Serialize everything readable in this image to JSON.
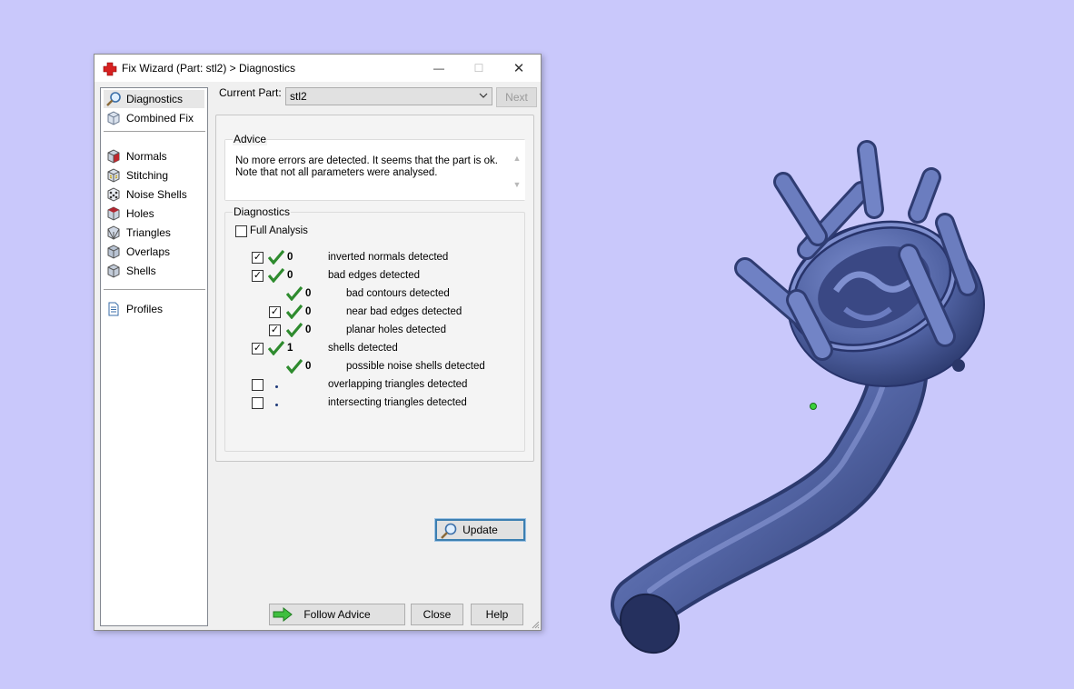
{
  "window": {
    "title": "Fix Wizard (Part: stl2) > Diagnostics",
    "minimize": "—",
    "maximize": "☐",
    "close": "✕"
  },
  "nav": {
    "items": [
      {
        "label": "Diagnostics",
        "icon": "magnifier-icon"
      },
      {
        "label": "Combined Fix",
        "icon": "cube-icon"
      },
      {
        "label": "Normals",
        "icon": "normals-cube-icon"
      },
      {
        "label": "Stitching",
        "icon": "stitching-cube-icon"
      },
      {
        "label": "Noise Shells",
        "icon": "noise-shells-cube-icon"
      },
      {
        "label": "Holes",
        "icon": "holes-cube-icon"
      },
      {
        "label": "Triangles",
        "icon": "triangles-cube-icon"
      },
      {
        "label": "Overlaps",
        "icon": "overlaps-cube-icon"
      },
      {
        "label": "Shells",
        "icon": "shells-cube-icon"
      },
      {
        "label": "Profiles",
        "icon": "document-icon"
      }
    ]
  },
  "current_part": {
    "label": "Current Part:",
    "value": "stl2",
    "next_label": "Next"
  },
  "advice": {
    "title": "Advice",
    "line1": "No more errors are detected. It seems that the part is ok.",
    "line2": "Note that not all parameters were analysed."
  },
  "diagnostics": {
    "title": "Diagnostics",
    "full_analysis": "Full Analysis",
    "rows": [
      {
        "checked": true,
        "status": "ok",
        "count": "0",
        "label": "inverted normals detected"
      },
      {
        "checked": true,
        "status": "ok",
        "count": "0",
        "label": "bad edges detected"
      },
      {
        "checked": null,
        "status": "ok",
        "count": "0",
        "label": "bad contours detected"
      },
      {
        "checked": true,
        "status": "ok",
        "count": "0",
        "label": "near bad edges detected"
      },
      {
        "checked": true,
        "status": "ok",
        "count": "0",
        "label": "planar holes detected"
      },
      {
        "checked": true,
        "status": "ok",
        "count": "1",
        "label": "shells detected"
      },
      {
        "checked": null,
        "status": "ok",
        "count": "0",
        "label": "possible noise shells detected"
      },
      {
        "checked": false,
        "status": "none",
        "count": "",
        "label": "overlapping triangles detected"
      },
      {
        "checked": false,
        "status": "none",
        "count": "",
        "label": "intersecting triangles detected"
      }
    ],
    "update_label": "Update"
  },
  "buttons": {
    "follow_advice": "Follow Advice",
    "close": "Close",
    "help": "Help"
  },
  "colors": {
    "background": "#c9c8fb",
    "model": "#5466a6",
    "tick": "#2e8b2e"
  }
}
